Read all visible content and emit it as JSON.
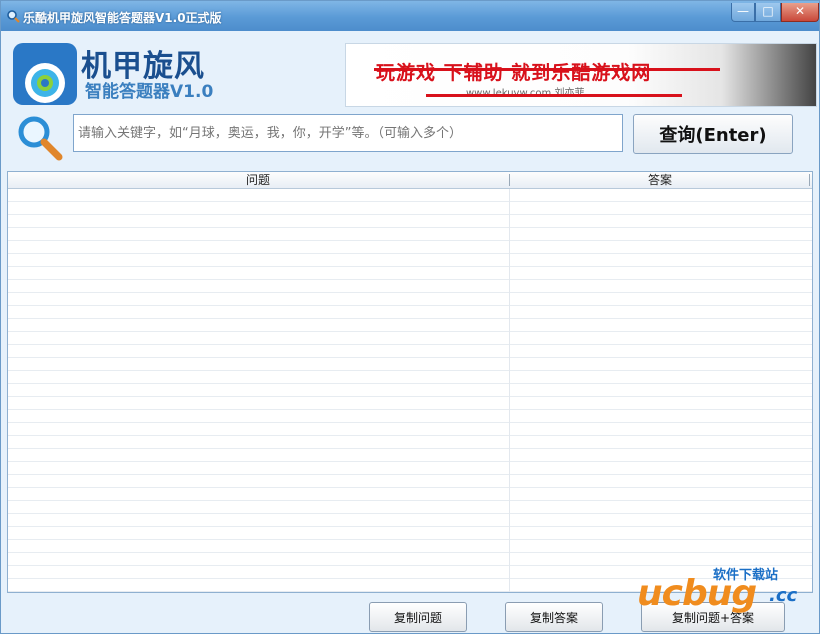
{
  "window": {
    "title": "乐酷机甲旋风智能答题器V1.0正式版",
    "minimize_glyph": "—",
    "maximize_glyph": "□",
    "close_glyph": "✕"
  },
  "logo": {
    "title": "机甲旋风",
    "subtitle": "智能答题器V1.0"
  },
  "banner": {
    "text": "玩游戏 下辅助 就到乐酷游戏网",
    "url": "www.lekuvw.com  刘亦菲"
  },
  "search": {
    "placeholder": "请输入关键字，如“月球，奥运，我，你，开学”等。（可输入多个）",
    "value": "",
    "button_label": "查询(Enter)",
    "icon": "magnifier-icon"
  },
  "table": {
    "columns": [
      "问题",
      "答案"
    ],
    "rows": []
  },
  "actions": {
    "copy_question": "复制问题",
    "copy_answer": "复制答案",
    "copy_both": "复制问题+答案"
  },
  "watermark": {
    "site_name": "软件下载站",
    "logo_text": "ucbug",
    "domain": ".cc"
  },
  "colors": {
    "title_bar": "#5a9ad6",
    "accent_blue": "#1a4f8f",
    "banner_red": "#d8111b",
    "watermark_orange": "#f08c1e"
  }
}
